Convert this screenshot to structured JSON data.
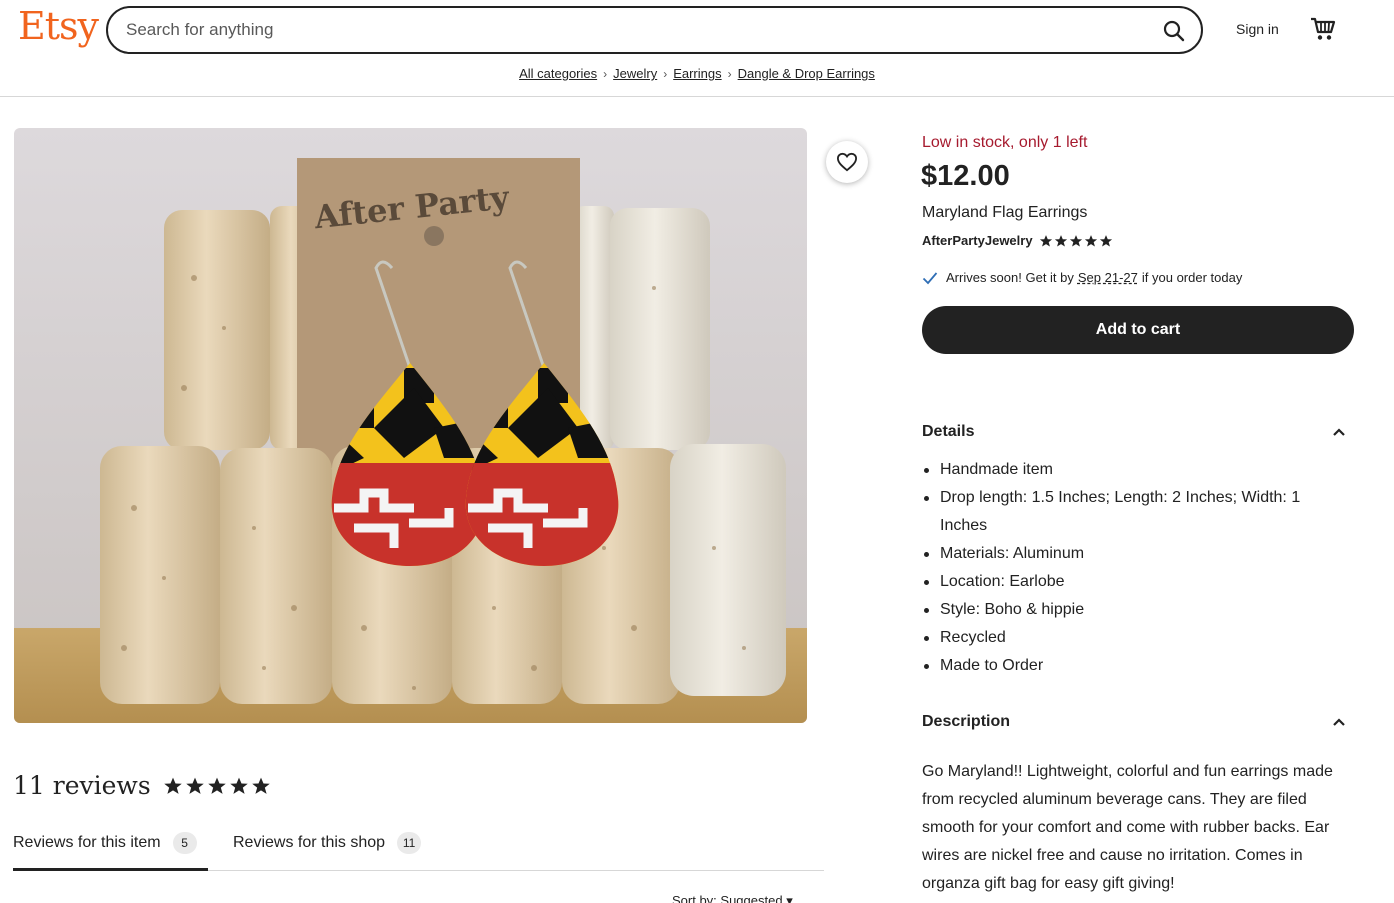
{
  "header": {
    "logo": "Etsy",
    "search_placeholder": "Search for anything",
    "signin_label": "Sign in"
  },
  "breadcrumb": [
    "All categories",
    "Jewelry",
    "Earrings",
    "Dangle & Drop Earrings"
  ],
  "product": {
    "stock_notice": "Low in stock, only 1 left",
    "price": "$12.00",
    "title": "Maryland Flag Earrings",
    "shop_name": "AfterPartyJewelry",
    "shop_rating": 5,
    "delivery_prefix": "Arrives soon! Get it by",
    "delivery_dates": "Sep 21-27",
    "delivery_suffix": "if you order today",
    "add_to_cart_label": "Add to cart",
    "photo_card_text": "After Party"
  },
  "details": {
    "heading": "Details",
    "items": [
      "Handmade item",
      "Drop length: 1.5 Inches; Length: 2 Inches; Width: 1 Inches",
      "Materials: Aluminum",
      "Location: Earlobe",
      "Style: Boho & hippie",
      "Recycled",
      "Made to Order"
    ]
  },
  "description": {
    "heading": "Description",
    "text": "Go Maryland!! Lightweight, colorful and fun earrings made from recycled aluminum beverage cans. They are filed smooth for your comfort and come with rubber backs. Ear wires are nickel free and cause no irritation. Comes in organza gift bag for easy gift giving!"
  },
  "reviews": {
    "heading": "11 reviews",
    "rating": 5,
    "tabs": [
      {
        "label": "Reviews for this item",
        "count": "5"
      },
      {
        "label": "Reviews for this shop",
        "count": "11"
      }
    ],
    "sort_label": "Sort by: Suggested"
  },
  "colors": {
    "brand_orange": "#f1641e",
    "stock_red": "#a61a2e",
    "button_dark": "#222222"
  },
  "icons": [
    "search-icon",
    "cart-icon",
    "heart-icon",
    "chevron-right-icon",
    "star-icon",
    "check-icon",
    "chevron-up-icon",
    "chevron-down-icon"
  ]
}
